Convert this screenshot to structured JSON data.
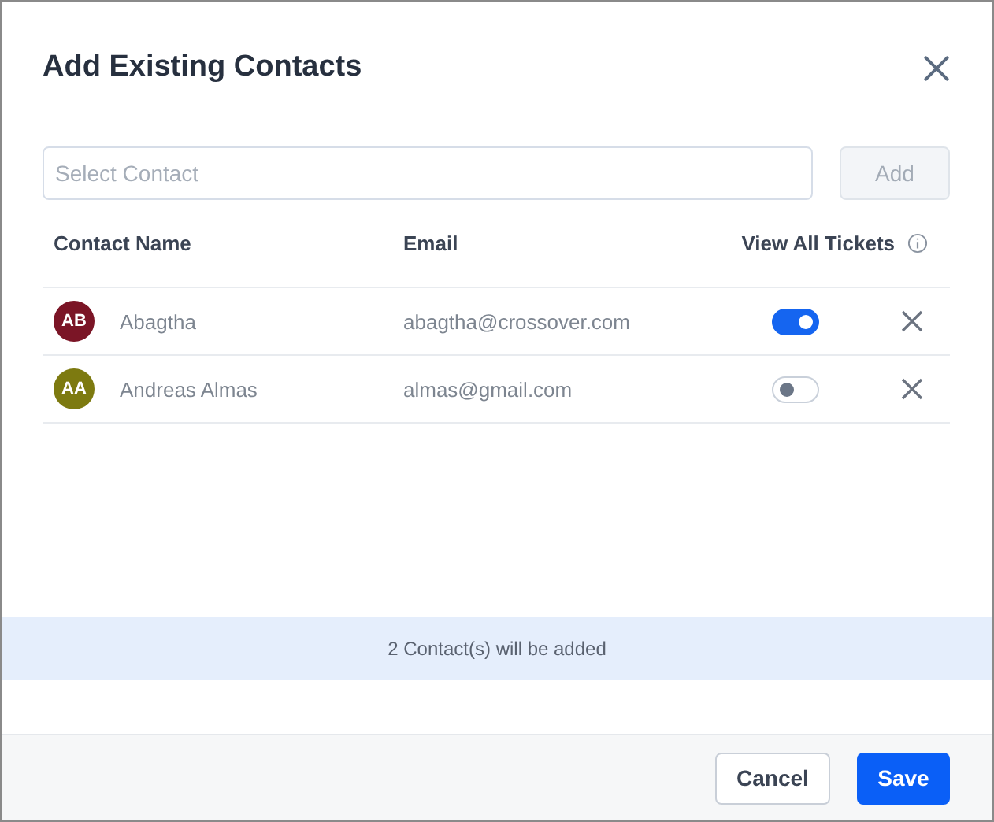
{
  "dialog": {
    "title": "Add Existing Contacts"
  },
  "search": {
    "placeholder": "Select Contact"
  },
  "add_button": "Add",
  "table": {
    "columns": [
      "Contact Name",
      "Email",
      "View All Tickets"
    ],
    "rows": [
      {
        "initials": "AB",
        "color": "#7b1526",
        "name": "Abagtha",
        "email": "abagtha@crossover.com",
        "view_all_tickets": true
      },
      {
        "initials": "AA",
        "color": "#7d7a10",
        "name": "Andreas Almas",
        "email": "almas@gmail.com",
        "view_all_tickets": false
      }
    ]
  },
  "notice": "2 Contact(s) will be added",
  "buttons": {
    "cancel": "Cancel",
    "save": "Save"
  }
}
